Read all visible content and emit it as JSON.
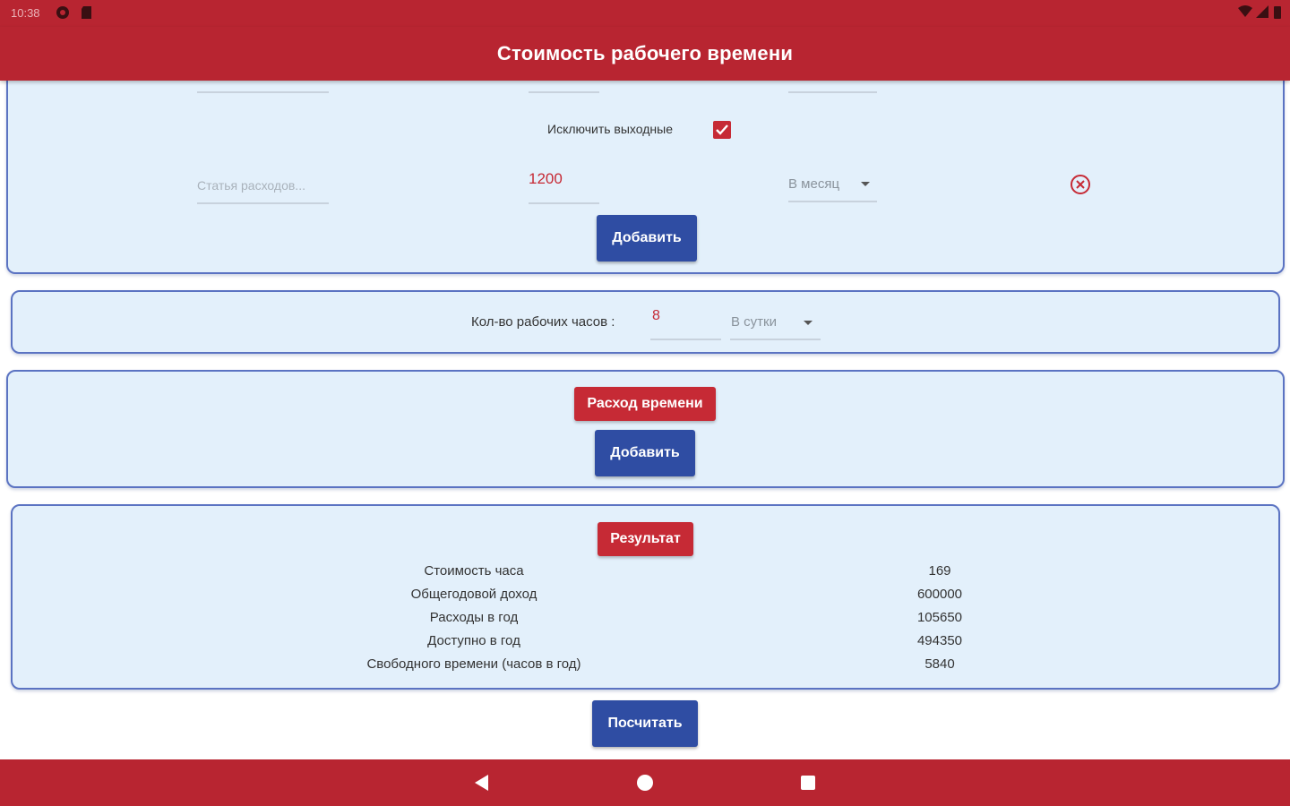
{
  "status_bar": {
    "time": "10:38"
  },
  "app_bar": {
    "title": "Стоимость рабочего времени"
  },
  "expenses_card": {
    "exclude_weekends_label": "Исключить выходные",
    "exclude_weekends_checked": true,
    "item": {
      "name_placeholder": "Статья расходов...",
      "amount": "1200",
      "period": "В месяц"
    },
    "add_label": "Добавить"
  },
  "hours_card": {
    "label": "Кол-во рабочих часов :",
    "hours_value": "8",
    "period": "В сутки"
  },
  "time_card": {
    "header": "Расход времени",
    "add_label": "Добавить"
  },
  "result_card": {
    "header": "Результат",
    "rows": [
      {
        "label": "Стоимость часа",
        "value": "169"
      },
      {
        "label": "Общегодовой доход",
        "value": "600000"
      },
      {
        "label": "Расходы в год",
        "value": "105650"
      },
      {
        "label": "Доступно в год",
        "value": "494350"
      },
      {
        "label": "Свободного времени (часов в год)",
        "value": "5840"
      }
    ]
  },
  "calculate_label": "Посчитать",
  "colors": {
    "primary": "#b82531",
    "accent": "#2f4da3",
    "card": "#e3f0fb"
  },
  "icons": [
    "gear-icon",
    "sd-card-icon",
    "wifi-icon",
    "signal-icon",
    "battery-icon",
    "remove-circle-icon",
    "back-icon",
    "home-icon",
    "recents-icon"
  ]
}
